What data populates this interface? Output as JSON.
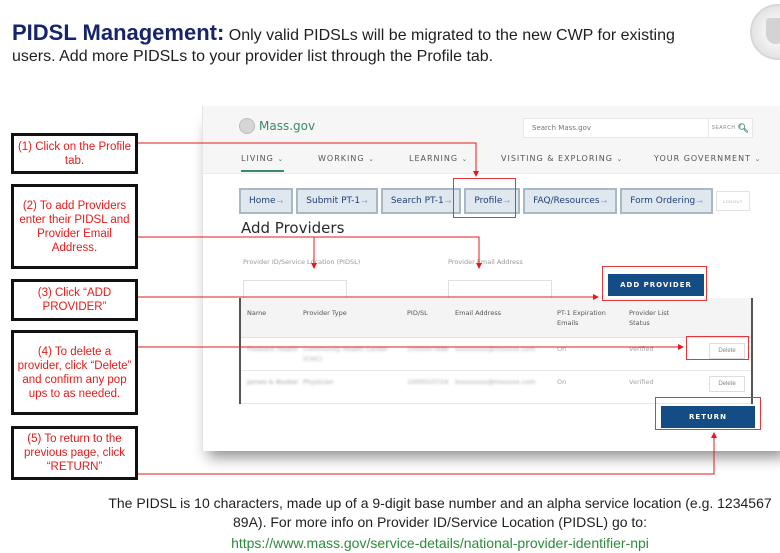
{
  "heading": {
    "bold": "PIDSL Management:",
    "text": " Only valid PIDSLs will be migrated to the new CWP for existing users. Add more PIDSLs to your provider list through the Profile tab."
  },
  "site": {
    "logo_text": "Mass.gov",
    "search_placeholder": "Search Mass.gov",
    "search_button": "SEARCH",
    "nav": [
      {
        "label": "LIVING"
      },
      {
        "label": "WORKING"
      },
      {
        "label": "LEARNING"
      },
      {
        "label": "VISITING & EXPLORING"
      },
      {
        "label": "YOUR GOVERNMENT"
      }
    ],
    "tabs": [
      {
        "label": "Home"
      },
      {
        "label": "Submit PT-1"
      },
      {
        "label": "Search PT-1"
      },
      {
        "label": "Profile"
      },
      {
        "label": "FAQ/Resources"
      },
      {
        "label": "Form Ordering"
      }
    ],
    "logout": "LOGOUT"
  },
  "page": {
    "title": "Add Providers",
    "pidsl_label": "Provider ID/Service Location (PIDSL)",
    "email_label": "Provider Email Address",
    "pidsl_value": "",
    "email_value": "",
    "add_button": "ADD PROVIDER",
    "return_button": "RETURN",
    "table": {
      "headers": [
        "Name",
        "Provider Type",
        "PID/SL",
        "Email Address",
        "PT-1 Expiration Emails",
        "Provider List Status"
      ],
      "rows": [
        {
          "name": "Pleasant Health",
          "type": "Community Health Center (CHC)",
          "pidsl": "1000007896",
          "email": "lxxxxxxxx@mxxxxx.com",
          "expiration": "On",
          "status": "Verified",
          "action": "Delete"
        },
        {
          "name": "James & Booker",
          "type": "Physician",
          "pidsl": "1000010724",
          "email": "lxxxxxxxx@mxxxxx.com",
          "expiration": "On",
          "status": "Verified",
          "action": "Delete"
        }
      ]
    }
  },
  "callouts": [
    "(1) Click on the Profile tab.",
    "(2) To add Providers enter their PIDSL and Provider Email Address.",
    "(3) Click “ADD PROVIDER”",
    "(4) To delete a provider, click “Delete” and confirm any pop ups to as needed.",
    "(5) To return to the previous page, click “RETURN”"
  ],
  "footer": {
    "text": "The PIDSL is 10 characters, made up of a 9-digit base number and an alpha service location (e.g. 1234567 89A). For more info on Provider ID/Service Location (PIDSL) go to:",
    "link": "https://www.mass.gov/service-details/national-provider-identifier-npi"
  },
  "colors": {
    "callout_red": "#e41b1b",
    "title_navy": "#17246b",
    "button_blue": "#144c86",
    "link_green": "#2e8a3c"
  }
}
